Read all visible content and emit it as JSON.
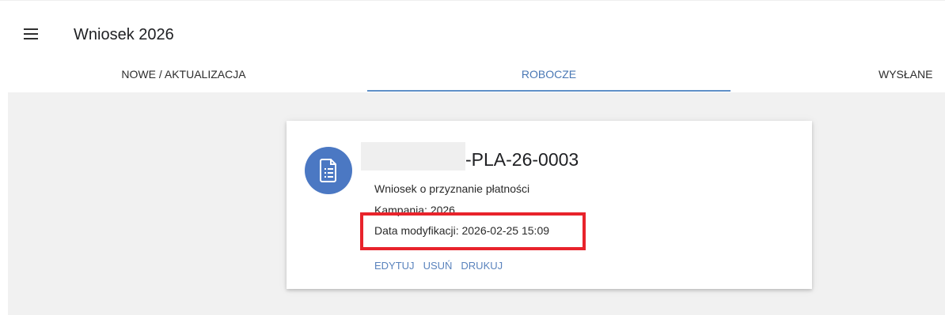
{
  "header": {
    "title": "Wniosek 2026",
    "menu_icon": "hamburger-menu-icon"
  },
  "tabs": [
    {
      "label": "NOWE / AKTUALIZACJA",
      "active": false
    },
    {
      "label": "ROBOCZE",
      "active": true
    },
    {
      "label": "WYSŁANE",
      "active": false
    }
  ],
  "card": {
    "icon": "document-list-icon",
    "application_number_suffix": "-PLA-26-0003",
    "type": "Wniosek o przyznanie płatności",
    "campaign": "Kampania: 2026",
    "modified": "Data modyfikacji: 2026-02-25 15:09",
    "actions": {
      "edit": "EDYTUJ",
      "delete": "USUŃ",
      "print": "DRUKUJ"
    }
  },
  "colors": {
    "accent": "#4b78c3",
    "tab_active": "#4a78b5",
    "highlight": "#e8232b",
    "background": "#f1f1f1"
  }
}
